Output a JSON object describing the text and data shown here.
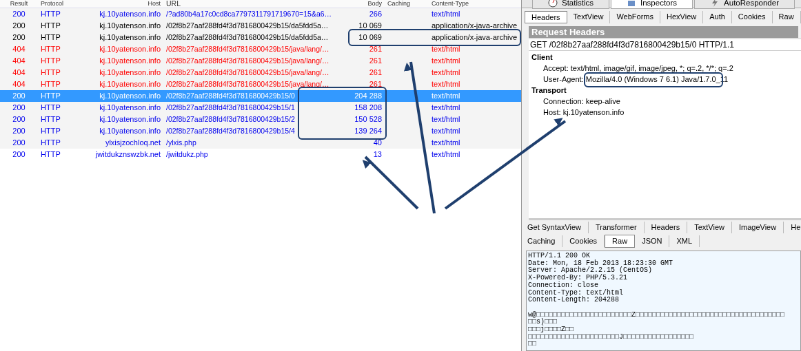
{
  "sessions": {
    "columns": [
      "Result",
      "Protocol",
      "Host",
      "URL",
      "Body",
      "Caching",
      "Content-Type"
    ],
    "rows": [
      {
        "result": "200",
        "protocol": "HTTP",
        "host": "kj.10yatenson.info",
        "url": "/?ad80b4a17c0cd8ca7797311791719670=15&a6…",
        "body": "266",
        "content_type": "text/html",
        "color": "#0000ee",
        "selected": false
      },
      {
        "result": "200",
        "protocol": "HTTP",
        "host": "kj.10yatenson.info",
        "url": "/02f8b27aaf288fd4f3d7816800429b15/da5fdd5a…",
        "body": "10 069",
        "content_type": "application/x-java-archive",
        "color": "#000000",
        "selected": false
      },
      {
        "result": "200",
        "protocol": "HTTP",
        "host": "kj.10yatenson.info",
        "url": "/02f8b27aaf288fd4f3d7816800429b15/da5fdd5a…",
        "body": "10 069",
        "content_type": "application/x-java-archive",
        "color": "#000000",
        "selected": false
      },
      {
        "result": "404",
        "protocol": "HTTP",
        "host": "kj.10yatenson.info",
        "url": "/02f8b27aaf288fd4f3d7816800429b15/java/lang/…",
        "body": "261",
        "content_type": "text/html",
        "color": "#ff0000",
        "selected": false
      },
      {
        "result": "404",
        "protocol": "HTTP",
        "host": "kj.10yatenson.info",
        "url": "/02f8b27aaf288fd4f3d7816800429b15/java/lang/…",
        "body": "261",
        "content_type": "text/html",
        "color": "#ff0000",
        "selected": false
      },
      {
        "result": "404",
        "protocol": "HTTP",
        "host": "kj.10yatenson.info",
        "url": "/02f8b27aaf288fd4f3d7816800429b15/java/lang/…",
        "body": "261",
        "content_type": "text/html",
        "color": "#ff0000",
        "selected": false
      },
      {
        "result": "404",
        "protocol": "HTTP",
        "host": "kj.10yatenson.info",
        "url": "/02f8b27aaf288fd4f3d7816800429b15/java/lang/…",
        "body": "261",
        "content_type": "text/html",
        "color": "#ff0000",
        "selected": false
      },
      {
        "result": "200",
        "protocol": "HTTP",
        "host": "kj.10yatenson.info",
        "url": "/02f8b27aaf288fd4f3d7816800429b15/0",
        "body": "204 288",
        "content_type": "text/html",
        "selected": true
      },
      {
        "result": "200",
        "protocol": "HTTP",
        "host": "kj.10yatenson.info",
        "url": "/02f8b27aaf288fd4f3d7816800429b15/1",
        "body": "158 208",
        "content_type": "text/html",
        "color": "#0000ee",
        "selected": false
      },
      {
        "result": "200",
        "protocol": "HTTP",
        "host": "kj.10yatenson.info",
        "url": "/02f8b27aaf288fd4f3d7816800429b15/2",
        "body": "150 528",
        "content_type": "text/html",
        "color": "#0000ee",
        "selected": false
      },
      {
        "result": "200",
        "protocol": "HTTP",
        "host": "kj.10yatenson.info",
        "url": "/02f8b27aaf288fd4f3d7816800429b15/4",
        "body": "139 264",
        "content_type": "text/html",
        "color": "#0000ee",
        "selected": false
      },
      {
        "result": "200",
        "protocol": "HTTP",
        "host": "ylxisjzochloq.net",
        "url": "/ylxis.php",
        "body": "40",
        "content_type": "text/html",
        "color": "#0000ee",
        "selected": false
      },
      {
        "result": "200",
        "protocol": "HTTP",
        "host": "jwitdukznswzbk.net",
        "url": "/jwitdukz.php",
        "body": "13",
        "content_type": "text/html",
        "color": "#0000ee",
        "selected": false
      }
    ]
  },
  "main_tabs": [
    {
      "label": "Statistics",
      "selected": false
    },
    {
      "label": "Inspectors",
      "selected": true
    },
    {
      "label": "AutoResponder",
      "selected": false
    }
  ],
  "request_tabs": [
    {
      "label": "Headers",
      "selected": true
    },
    {
      "label": "TextView",
      "selected": false
    },
    {
      "label": "WebForms",
      "selected": false
    },
    {
      "label": "HexView",
      "selected": false
    },
    {
      "label": "Auth",
      "selected": false
    },
    {
      "label": "Cookies",
      "selected": false
    },
    {
      "label": "Raw",
      "selected": false
    }
  ],
  "request_headers": {
    "title": "Request Headers",
    "request_line": "GET /02f8b27aaf288fd4f3d7816800429b15/0 HTTP/1.1",
    "groups": [
      {
        "name": "Client",
        "headers": [
          {
            "key": "Accept:",
            "value": "text/html, image/gif, image/jpeg, *; q=.2, */*; q=.2"
          },
          {
            "key": "User-Agent:",
            "value": "Mozilla/4.0 (Windows 7 6.1) Java/1.7.0_11"
          }
        ]
      },
      {
        "name": "Transport",
        "headers": [
          {
            "key": "Connection:",
            "value": "keep-alive"
          },
          {
            "key": "Host:",
            "value": "kj.10yatenson.info"
          }
        ]
      }
    ]
  },
  "response_tabs_row1": [
    {
      "label": "Get SyntaxView",
      "selected": false
    },
    {
      "label": "Transformer",
      "selected": false
    },
    {
      "label": "Headers",
      "selected": false
    },
    {
      "label": "TextView",
      "selected": false
    },
    {
      "label": "ImageView",
      "selected": false
    },
    {
      "label": "He",
      "selected": false
    }
  ],
  "response_tabs_row2": [
    {
      "label": "Caching",
      "selected": false
    },
    {
      "label": "Cookies",
      "selected": false
    },
    {
      "label": "Raw",
      "selected": true
    },
    {
      "label": "JSON",
      "selected": false
    },
    {
      "label": "XML",
      "selected": false
    }
  ],
  "raw_response": {
    "headers": [
      "HTTP/1.1 200 OK",
      "Date: Mon, 18 Feb 2013 18:23:30 GMT",
      "Server: Apache/2.2.15 (CentOS)",
      "X-Powered-By: PHP/5.3.21",
      "Connection: close",
      "Content-Type: text/html",
      "Content-Length: 204288"
    ],
    "body": [
      "w@□□□□□□□□□□□□□□□□□□□□□□□Z□□□□□□□□□□□□□□□□□□□□□□□□□□□□□□□□□□□□",
      "□□s)□□□",
      "□□□j□□□□Z□□",
      "□□□□□□□□□□□□□□□□□□□□□□J□□□□□□□□□□□□□□□□□",
      "□□"
    ]
  }
}
